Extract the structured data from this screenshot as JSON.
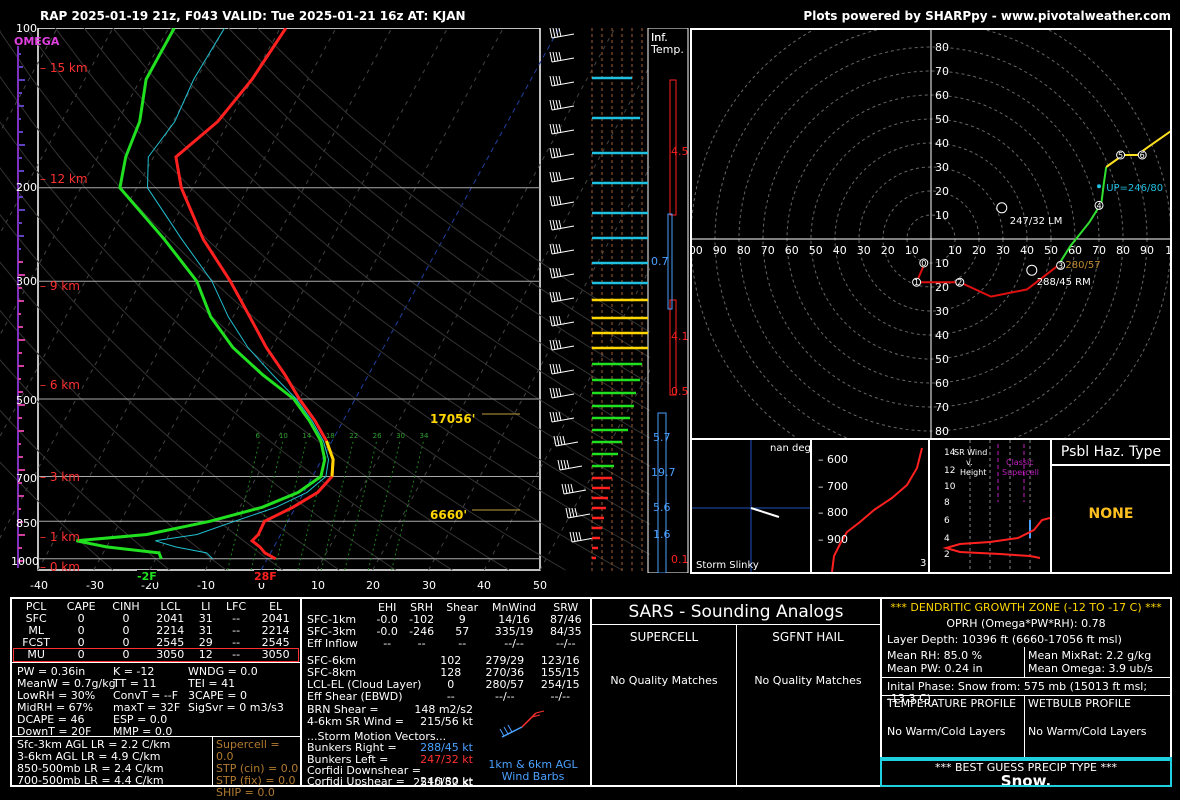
{
  "header": {
    "title": "RAP 2025-01-19 21z, F043  VALID: Tue 2025-01-21 16z  AT: KJAN",
    "credit": "Plots powered by SHARPpy - www.pivotalweather.com"
  },
  "skewt": {
    "omega_label": "OMEGA",
    "pressure_labels": [
      "100",
      "200",
      "300",
      "500",
      "700",
      "850",
      "1000"
    ],
    "height_labels": [
      "15 km",
      "12 km",
      "9 km",
      "6 km",
      "3 km",
      "1 km",
      "0 km"
    ],
    "temp_ticks": [
      "-40",
      "-30",
      "-20",
      "-10",
      "0",
      "10",
      "20",
      "30",
      "40",
      "50"
    ],
    "sfc_td_label": "-2F",
    "sfc_t_label": "28F",
    "dgz_top_label": "17056'",
    "dgz_bot_label": "6660'",
    "mixing_ratio_labels": [
      "6",
      "10",
      "14",
      "18",
      "22",
      "26",
      "30",
      "34"
    ],
    "temp_profile": [
      [
        1000,
        1.5
      ],
      [
        975,
        -1
      ],
      [
        950,
        -2.5
      ],
      [
        925,
        -4.5
      ],
      [
        900,
        -4
      ],
      [
        850,
        -4.2
      ],
      [
        800,
        -0.5
      ],
      [
        750,
        2.5
      ],
      [
        700,
        3.5
      ],
      [
        650,
        2.0
      ],
      [
        600,
        -1.0
      ],
      [
        550,
        -5
      ],
      [
        500,
        -10
      ],
      [
        450,
        -15
      ],
      [
        400,
        -21
      ],
      [
        350,
        -27
      ],
      [
        300,
        -34
      ],
      [
        250,
        -43
      ],
      [
        200,
        -52
      ],
      [
        175,
        -56
      ],
      [
        150,
        -52
      ],
      [
        125,
        -50
      ],
      [
        100,
        -49
      ]
    ],
    "dewp_profile": [
      [
        1000,
        -19
      ],
      [
        975,
        -20
      ],
      [
        950,
        -30
      ],
      [
        925,
        -36
      ],
      [
        900,
        -24
      ],
      [
        850,
        -14
      ],
      [
        800,
        -6
      ],
      [
        750,
        -1
      ],
      [
        700,
        1.5
      ],
      [
        650,
        0.5
      ],
      [
        600,
        -2
      ],
      [
        550,
        -6
      ],
      [
        500,
        -11
      ],
      [
        450,
        -19
      ],
      [
        400,
        -27
      ],
      [
        350,
        -34
      ],
      [
        300,
        -40
      ],
      [
        250,
        -50
      ],
      [
        200,
        -63
      ],
      [
        175,
        -65
      ],
      [
        150,
        -66
      ],
      [
        125,
        -69
      ],
      [
        100,
        -69
      ]
    ]
  },
  "chart_data": [
    {
      "type": "line",
      "title": "Skew-T log-P",
      "xlabel": "",
      "ylabel": "",
      "x_units": "C",
      "y_units": "mb",
      "xlim": [
        -40,
        50
      ],
      "ylim": [
        1050,
        100
      ],
      "log_y": true,
      "series": [
        {
          "name": "Temperature",
          "color": "#ff2020",
          "points": [
            [
              1000,
              1.5
            ],
            [
              975,
              -1
            ],
            [
              950,
              -2.5
            ],
            [
              925,
              -4.5
            ],
            [
              900,
              -4
            ],
            [
              850,
              -4.2
            ],
            [
              800,
              -0.5
            ],
            [
              750,
              2.5
            ],
            [
              700,
              3.5
            ],
            [
              650,
              2.0
            ],
            [
              600,
              -1.0
            ],
            [
              550,
              -5
            ],
            [
              500,
              -10
            ],
            [
              450,
              -15
            ],
            [
              400,
              -21
            ],
            [
              350,
              -27
            ],
            [
              300,
              -34
            ],
            [
              250,
              -43
            ],
            [
              200,
              -52
            ],
            [
              175,
              -56
            ],
            [
              150,
              -52
            ],
            [
              125,
              -50
            ],
            [
              100,
              -49
            ]
          ]
        },
        {
          "name": "Dewpoint",
          "color": "#20e020",
          "points": [
            [
              1000,
              -19
            ],
            [
              975,
              -20
            ],
            [
              950,
              -30
            ],
            [
              925,
              -36
            ],
            [
              900,
              -24
            ],
            [
              850,
              -14
            ],
            [
              800,
              -6
            ],
            [
              750,
              -1
            ],
            [
              700,
              1.5
            ],
            [
              650,
              0.5
            ],
            [
              600,
              -2
            ],
            [
              550,
              -6
            ],
            [
              500,
              -11
            ],
            [
              450,
              -19
            ],
            [
              400,
              -27
            ],
            [
              350,
              -34
            ],
            [
              300,
              -40
            ],
            [
              250,
              -50
            ],
            [
              200,
              -63
            ],
            [
              175,
              -65
            ],
            [
              150,
              -66
            ],
            [
              125,
              -69
            ],
            [
              100,
              -69
            ]
          ]
        }
      ]
    },
    {
      "type": "scatter",
      "title": "Hodograph",
      "xlim": [
        -100,
        100
      ],
      "ylim": [
        -85,
        85
      ],
      "rings": [
        10,
        20,
        30,
        40,
        50,
        60,
        70,
        80,
        90
      ],
      "markers": [
        {
          "label": "0"
        },
        {
          "label": "1"
        },
        {
          "label": "2"
        },
        {
          "label": "3"
        },
        {
          "label": "4"
        },
        {
          "label": "5"
        },
        {
          "label": "6"
        }
      ],
      "annotations": [
        "UP=246/80",
        "247/32 LM",
        "288/45 RM",
        "280/57"
      ]
    }
  ],
  "infl_temp": {
    "title1": "Inf.",
    "title2": "Temp.",
    "values": [
      "4.5",
      "0.7",
      "4.1",
      "0.5",
      "5.7",
      "19.7",
      "5.6",
      "1.6",
      "0.1"
    ]
  },
  "hodo": {
    "x_labels": [
      "00",
      "90",
      "80",
      "70",
      "60",
      "50",
      "40",
      "30",
      "20",
      "10",
      "10",
      "20",
      "30",
      "40",
      "50",
      "60",
      "70",
      "80",
      "90",
      "1"
    ],
    "y_labels": [
      "80",
      "70",
      "60",
      "50",
      "40",
      "30",
      "20",
      "10",
      "10",
      "20",
      "30",
      "40",
      "50",
      "60",
      "70",
      "80"
    ],
    "up": "UP=246/80",
    "lm": "247/32 LM",
    "rm": "288/45 RM",
    "mean": "280/57"
  },
  "slinky": {
    "label": "Storm Slinky",
    "nan": "nan deg"
  },
  "theta": {
    "levels": [
      "600",
      "700",
      "800",
      "900"
    ]
  },
  "srwind": {
    "t1": "SR Wind",
    "t2": "v.",
    "t3": "Height",
    "classic": "Classic",
    "supercell": "Supercell",
    "ylabels": [
      "14",
      "12",
      "10",
      "8",
      "6",
      "4",
      "2"
    ],
    "xtick": "3"
  },
  "haz": {
    "title": "Psbl Haz. Type",
    "value": "NONE"
  },
  "parcels": {
    "headers": [
      "PCL",
      "CAPE",
      "CINH",
      "LCL",
      "LI",
      "LFC",
      "EL"
    ],
    "rows": [
      [
        "SFC",
        "0",
        "0",
        "2041",
        "31",
        "--",
        "2041"
      ],
      [
        "ML",
        "0",
        "0",
        "2214",
        "31",
        "--",
        "2214"
      ],
      [
        "FCST",
        "0",
        "0",
        "2545",
        "29",
        "--",
        "2545"
      ],
      [
        "MU",
        "0",
        "0",
        "3050",
        "12",
        "--",
        "3050"
      ]
    ]
  },
  "indices": {
    "col1": [
      "PW = 0.36in",
      "MeanW = 0.7g/kg",
      "LowRH = 30%",
      "MidRH = 67%",
      "DCAPE = 46",
      "DownT = 20F"
    ],
    "col2": [
      "K = -12",
      "TT = 11",
      "ConvT = --F",
      "maxT = 32F",
      "ESP = 0.0",
      "MMP = 0.0"
    ],
    "col3": [
      "WNDG = 0.0",
      "TEI = 41",
      "3CAPE = 0",
      "",
      "",
      "SigSvr = 0 m3/s3"
    ]
  },
  "lapse": [
    "Sfc-3km AGL LR = 2.2 C/km",
    "3-6km AGL LR = 4.9 C/km",
    "850-500mb LR = 2.4 C/km",
    "700-500mb LR = 4.4 C/km"
  ],
  "composites": [
    "Supercell = 0.0",
    "STP (cin) = 0.0",
    "STP (fix) = 0.0",
    "SHIP = 0.0"
  ],
  "kinematics": {
    "headers": [
      "",
      "EHI",
      "SRH",
      "Shear",
      "MnWind",
      "SRW"
    ],
    "rows": [
      [
        "SFC-1km",
        "-0.0",
        "-102",
        "9",
        "14/16",
        "87/46"
      ],
      [
        "SFC-3km",
        "-0.0",
        "-246",
        "57",
        "335/19",
        "84/35"
      ],
      [
        "Eff Inflow",
        "--",
        "--",
        "--",
        "--/--",
        "--/--"
      ]
    ],
    "rows2": [
      [
        "SFC-6km",
        "",
        "",
        "102",
        "279/29",
        "123/16"
      ],
      [
        "SFC-8km",
        "",
        "",
        "128",
        "270/36",
        "155/15"
      ],
      [
        "LCL-EL (Cloud Layer)",
        "",
        "",
        "0",
        "280/57",
        "254/15"
      ],
      [
        "Eff Shear (EBWD)",
        "",
        "",
        "--",
        "--/--",
        "--/--"
      ]
    ],
    "brn_shear": "BRN Shear =",
    "brn_shear_val": "148 m2/s2",
    "sr_wind": "4-6km SR Wind =",
    "sr_wind_val": "215/56 kt",
    "storm_motion": "...Storm Motion Vectors...",
    "vectors": [
      {
        "label": "Bunkers Right =",
        "value": "288/45 kt",
        "color": "#4aa0ff"
      },
      {
        "label": "Bunkers Left =",
        "value": "247/32 kt",
        "color": "#ff3030"
      },
      {
        "label": "Corfidi Downshear =",
        "value": "251/152 kt",
        "color": "#ffffff"
      },
      {
        "label": "Corfidi Upshear =",
        "value": "246/80 kt",
        "color": "#ffffff"
      }
    ],
    "barb_label1": "1km & 6km AGL",
    "barb_label2": "Wind Barbs"
  },
  "sars": {
    "title": "SARS - Sounding Analogs",
    "supercell": "SUPERCELL",
    "hail": "SGFNT HAIL",
    "no_match1": "No Quality Matches",
    "no_match2": "No Quality Matches"
  },
  "dgz": {
    "title": "*** DENDRITIC GROWTH ZONE (-12 TO -17 C) ***",
    "oprh": "OPRH (Omega*PW*RH): 0.78",
    "depth": "Layer Depth: 10396 ft (6660-17056 ft msl)",
    "rh": "Mean RH: 85.0 %",
    "mixrat": "Mean MixRat: 2.2 g/kg",
    "pw": "Mean PW: 0.24 in",
    "omega": "Mean Omega: 3.9 ub/s",
    "phase": "Inital Phase: Snow from: 575 mb (15013 ft msl; -13.3 C)",
    "temp_prof": "TEMPERATURE PROFILE",
    "wetbulb_prof": "WETBULB PROFILE",
    "temp_val": "No Warm/Cold Layers",
    "wetbulb_val": "No Warm/Cold Layers",
    "precip_title": "*** BEST GUESS PRECIP TYPE ***",
    "precip_val": "Snow."
  },
  "colors": {
    "temp": "#ff2020",
    "dewp": "#20e020",
    "dgz": "#ffd700",
    "hodo_green": "#30e030",
    "hodo_red": "#e01010",
    "hodo_yellow": "#ffe020",
    "cyan": "#20d0e0",
    "orange": "#c08a30"
  }
}
